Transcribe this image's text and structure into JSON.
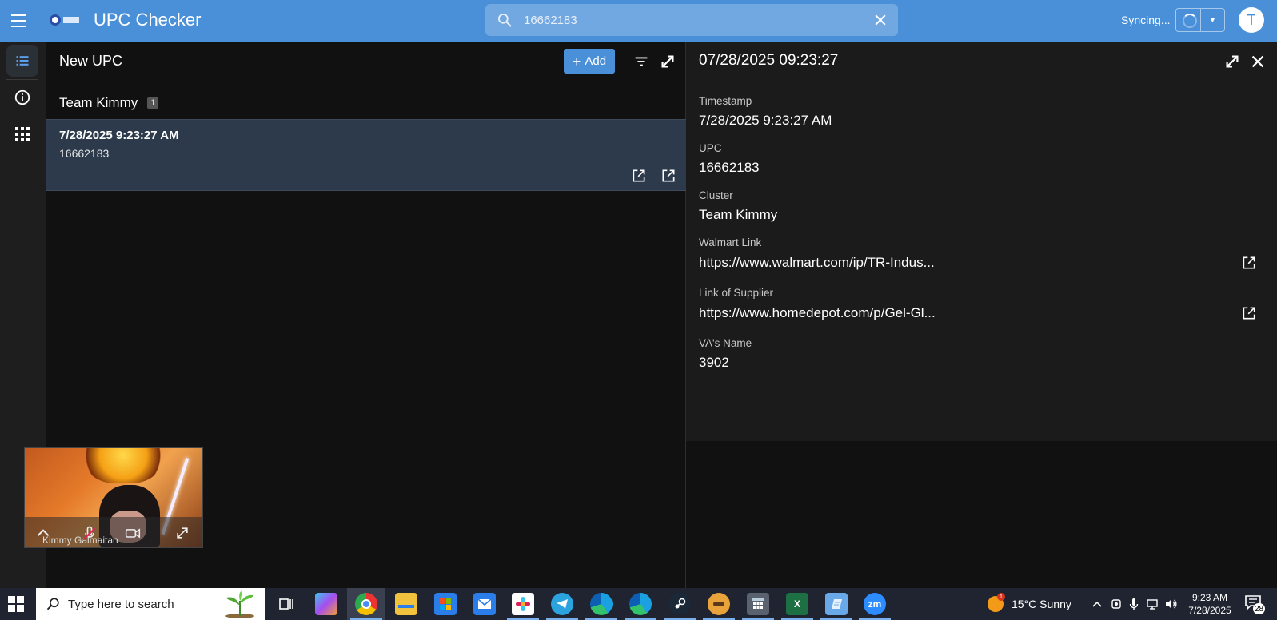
{
  "topbar": {
    "app_title": "UPC Checker",
    "search_value": "16662183",
    "sync_label": "Syncing...",
    "avatar_initial": "T"
  },
  "list": {
    "title": "New UPC",
    "add_label": "Add",
    "group_name": "Team Kimmy",
    "group_count": "1",
    "records": [
      {
        "timestamp": "7/28/2025 9:23:27 AM",
        "upc": "16662183"
      }
    ]
  },
  "detail": {
    "title": "07/28/2025 09:23:27",
    "fields": [
      {
        "label": "Timestamp",
        "value": "7/28/2025 9:23:27 AM"
      },
      {
        "label": "UPC",
        "value": "16662183"
      },
      {
        "label": "Cluster",
        "value": "Team Kimmy"
      },
      {
        "label": "Walmart Link",
        "value": "https://www.walmart.com/ip/TR-Indus..."
      },
      {
        "label": "Link of Supplier",
        "value": "https://www.homedepot.com/p/Gel-Gl..."
      },
      {
        "label": "VA's Name",
        "value": "3902"
      }
    ]
  },
  "video": {
    "participant_name": "Kimmy Galmaitan"
  },
  "taskbar": {
    "search_placeholder": "Type here to search",
    "weather_badge": "1",
    "weather": "15°C  Sunny",
    "time": "9:23 AM",
    "date": "7/28/2025",
    "notification_count": "28",
    "apps": [
      "task-view",
      "copilot",
      "chrome",
      "file-explorer",
      "ms-store",
      "mail",
      "slack",
      "telegram",
      "edge-profile-1",
      "edge-profile-2",
      "steam",
      "game",
      "calculator",
      "excel",
      "notepad",
      "zoom"
    ]
  },
  "colors": {
    "accent": "#4a90d9",
    "topbar": "#4a90d9",
    "selected_row": "#2c3a4c",
    "taskbar": "#1f2430"
  }
}
